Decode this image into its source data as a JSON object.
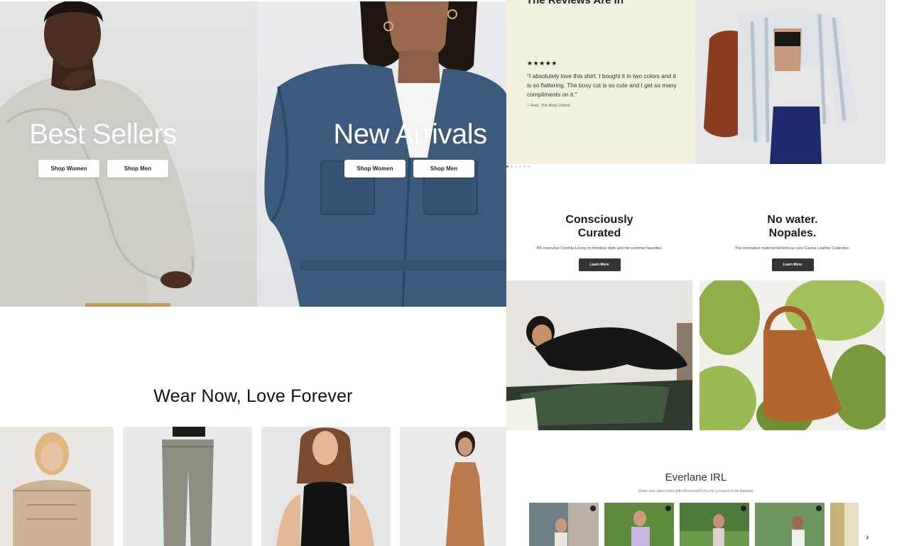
{
  "hero": {
    "left": {
      "title": "Best Sellers",
      "btn_women": "Shop Women",
      "btn_men": "Shop Men"
    },
    "right": {
      "title": "New Arrivals",
      "btn_women": "Shop Women",
      "btn_men": "Shop Men"
    }
  },
  "collection": {
    "title": "Wear Now, Love Forever"
  },
  "reviews": {
    "heading": "The Reviews Are In",
    "stars": "★★★★★",
    "quote": "\"I absolutely love this shirt. I bought it in two colors and it is so flattering. The boxy cut is so cute and I get so many compliments on it.\"",
    "attribution": "—Karli, The Boxy Oxford"
  },
  "features": [
    {
      "title": "Consciously\nCurated",
      "desc": "PR executive Cynthia Leung on timeless style and her summer favorites.",
      "button": "Learn More"
    },
    {
      "title": "No water.\nNopales.",
      "desc": "The innovative material behind our new Cactus Leather Collection.",
      "button": "Learn More"
    }
  ],
  "irl": {
    "title": "Everlane IRL",
    "subtitle": "Share your latest looks with #EverlaneOnYou for a chance to be featured."
  },
  "icons": {
    "carousel_next": "chevron-right-icon",
    "rating": "star-icon",
    "instagram": "camera-icon"
  }
}
